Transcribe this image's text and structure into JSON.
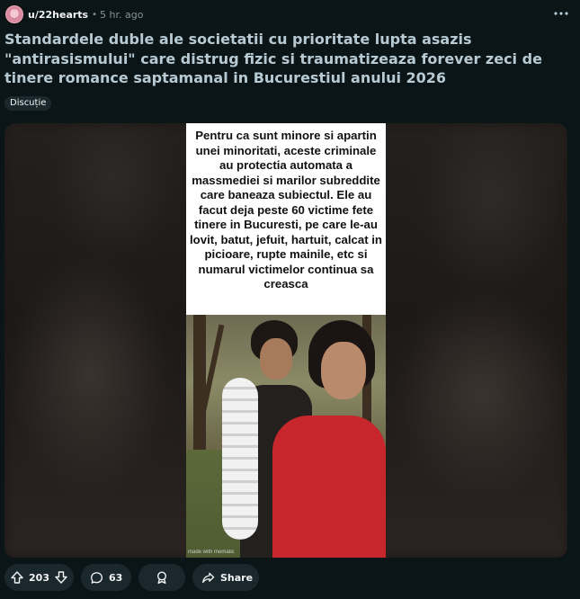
{
  "post": {
    "username": "u/22hearts",
    "separator": "•",
    "time": "5 hr. ago",
    "title": "Standardele duble ale societatii cu prioritate lupta asazis \"antirasismului\" care distrug fizic si traumatizeaza forever zeci de tinere romance saptamanal in Bucurestiul anului 2026",
    "flair": "Discuție",
    "more_icon": "more-horizontal-icon",
    "avatar_icon": "avatar-icon"
  },
  "media": {
    "meme_text": "Pentru ca sunt minore si apartin unei minoritati, aceste criminale au protectia automata a massmediei si marilor subreddite care baneaza subiectul.  Ele au facut deja peste 60 victime fete tinere in Bucuresti, pe care le-au lovit, batut, jefuit, hartuit, calcat in picioare, rupte mainile, etc si numarul victimelor continua sa creasca",
    "watermark": "made with mematic"
  },
  "actions": {
    "vote_count": "203",
    "comment_count": "63",
    "share_label": "Share",
    "upvote_icon": "upvote-arrow-icon",
    "downvote_icon": "downvote-arrow-icon",
    "comment_icon": "comment-bubble-icon",
    "award_icon": "award-icon",
    "share_icon": "share-arrow-icon"
  },
  "colors": {
    "background": "#0b1416",
    "pill": "#1a282d",
    "title_text": "#b7cad4",
    "meta_text": "#82959b"
  }
}
